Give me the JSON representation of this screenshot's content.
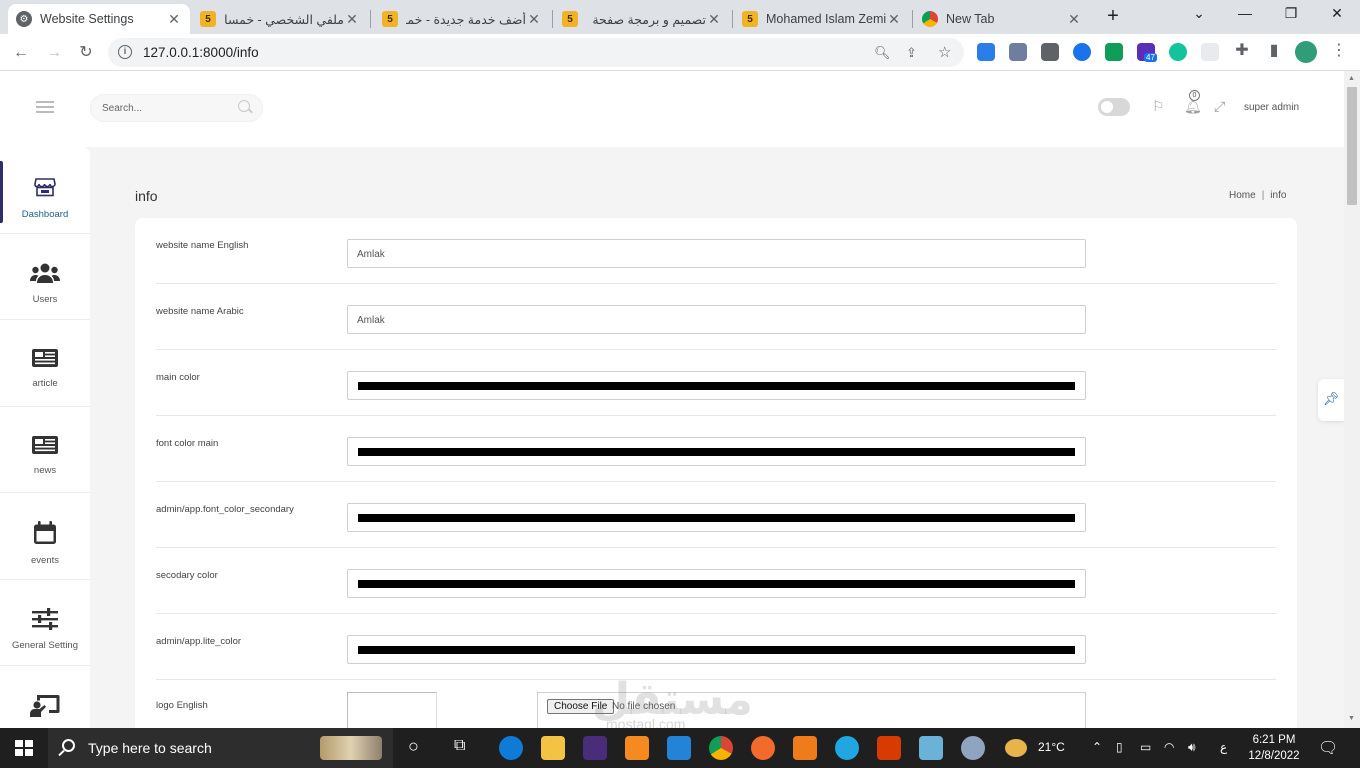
{
  "browser": {
    "tabs": [
      {
        "title": "Website Settings",
        "favicon": "settings-favicon",
        "active": true
      },
      {
        "title": "ملفي الشخصي - خمسات",
        "favicon": "khamsat-favicon"
      },
      {
        "title": "أضف خدمة جديدة - خمسات",
        "favicon": "khamsat-favicon"
      },
      {
        "title": "تصميم و برمجة صفحة",
        "favicon": "khamsat-favicon"
      },
      {
        "title": "Mohamed Islam Zemi",
        "favicon": "khamsat-favicon"
      },
      {
        "title": "New Tab",
        "favicon": "chrome-favicon"
      }
    ],
    "favicon_text": "5",
    "new_tab_glyph": "+",
    "url": "127.0.0.1:8000/info",
    "extensions_badge": "47"
  },
  "header": {
    "search_placeholder": "Search...",
    "notification_count": "0",
    "user_name": "super admin"
  },
  "sidebar": {
    "items": [
      {
        "label": "Dashboard",
        "icon": "store-icon",
        "active": true
      },
      {
        "label": "Users",
        "icon": "users-icon"
      },
      {
        "label": "article",
        "icon": "newspaper-icon"
      },
      {
        "label": "news",
        "icon": "newspaper-icon"
      },
      {
        "label": "events",
        "icon": "calendar-icon"
      },
      {
        "label": "General Setting",
        "icon": "sliders-icon"
      },
      {
        "label": "",
        "icon": "presentation-icon"
      }
    ]
  },
  "page": {
    "title": "info",
    "breadcrumb": {
      "home": "Home",
      "separator": "|",
      "current": "info"
    }
  },
  "form": {
    "fields": [
      {
        "label": "website name English",
        "type": "text",
        "value": "Amlak"
      },
      {
        "label": "website name Arabic",
        "type": "text",
        "value": "Amlak"
      },
      {
        "label": "main color",
        "type": "color",
        "value": "#000000"
      },
      {
        "label": "font color main",
        "type": "color",
        "value": "#000000"
      },
      {
        "label": "admin/app.font_color_secondary",
        "type": "color",
        "value": "#000000"
      },
      {
        "label": "secodary color",
        "type": "color",
        "value": "#000000"
      },
      {
        "label": "admin/app.lite_color",
        "type": "color",
        "value": "#000000"
      },
      {
        "label": "logo English",
        "type": "file",
        "button": "Choose File",
        "status": "No file chosen"
      }
    ]
  },
  "watermark": {
    "text": "مستقل",
    "domain": "mostaql.com"
  },
  "taskbar": {
    "search_placeholder": "Type here to search",
    "weather": "21°C",
    "language": "ع",
    "time": "6:21 PM",
    "date": "12/8/2022"
  },
  "colors": {
    "accent": "#2d2d6e",
    "active_label": "#1f5f8b",
    "page_bg": "#f4f4f4"
  }
}
